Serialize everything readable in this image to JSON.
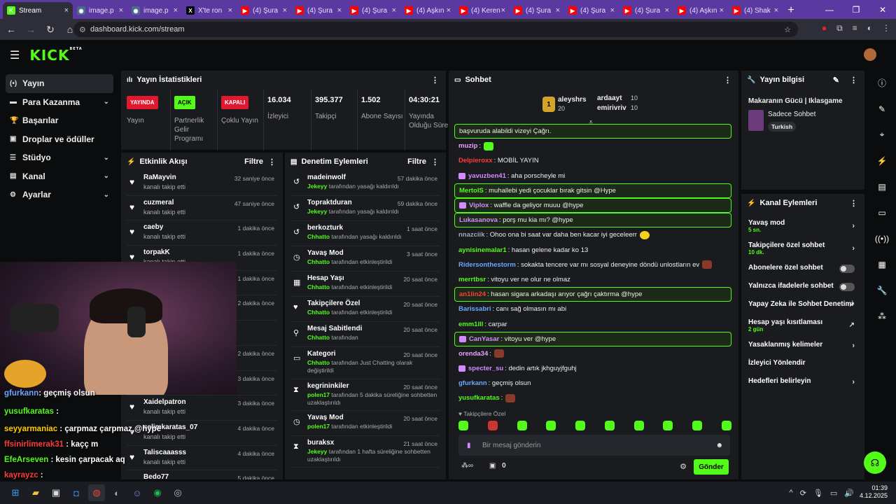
{
  "browser": {
    "tabs": [
      {
        "label": "Stream",
        "fav_color": "#53fc18",
        "fav_text": "K",
        "active": true
      },
      {
        "label": "image.p",
        "fav_color": "#4a6a8a",
        "fav_text": "◉"
      },
      {
        "label": "image.p",
        "fav_color": "#4a6a8a",
        "fav_text": "◉"
      },
      {
        "label": "X'te ron",
        "fav_color": "#000000",
        "fav_text": "X"
      },
      {
        "label": "(4) Şura",
        "fav_color": "#ff0000",
        "fav_text": "▶"
      },
      {
        "label": "(4) Şura",
        "fav_color": "#ff0000",
        "fav_text": "▶"
      },
      {
        "label": "(4) Şura",
        "fav_color": "#ff0000",
        "fav_text": "▶"
      },
      {
        "label": "(4) Aşkın",
        "fav_color": "#ff0000",
        "fav_text": "▶"
      },
      {
        "label": "(4) Keren",
        "fav_color": "#ff0000",
        "fav_text": "▶"
      },
      {
        "label": "(4) Şura",
        "fav_color": "#ff0000",
        "fav_text": "▶"
      },
      {
        "label": "(4) Şura",
        "fav_color": "#ff0000",
        "fav_text": "▶"
      },
      {
        "label": "(4) Şura",
        "fav_color": "#ff0000",
        "fav_text": "▶"
      },
      {
        "label": "(4) Aşkın",
        "fav_color": "#ff0000",
        "fav_text": "▶"
      },
      {
        "label": "(4) Shak",
        "fav_color": "#ff0000",
        "fav_text": "▶"
      }
    ],
    "url": "dashboard.kick.com/stream"
  },
  "sidebar": {
    "items": [
      {
        "label": "Yayın",
        "icon": "(•)",
        "active": true,
        "chevron": false
      },
      {
        "label": "Para Kazanma",
        "icon": "▬",
        "chevron": true
      },
      {
        "label": "Başarılar",
        "icon": "🏆",
        "chevron": false
      },
      {
        "label": "Droplar ve ödüller",
        "icon": "▣",
        "chevron": false
      },
      {
        "label": "Stüdyo",
        "icon": "☰",
        "chevron": true
      },
      {
        "label": "Kanal",
        "icon": "▤",
        "chevron": true
      },
      {
        "label": "Ayarlar",
        "icon": "⚙",
        "chevron": true
      }
    ]
  },
  "stats": {
    "title": "Yayın İstatistikleri",
    "items": [
      {
        "badge": "YAYINDA",
        "badge_color": "#e2182f",
        "label": "Yayın"
      },
      {
        "badge": "AÇIK",
        "badge_color": "#53fc18",
        "label": "Partnerlik Gelir Programı"
      },
      {
        "badge": "KAPALI",
        "badge_color": "#e2182f",
        "label": "Çoklu Yayın"
      },
      {
        "value": "16.034",
        "label": "İzleyici"
      },
      {
        "value": "395.377",
        "label": "Takipçi"
      },
      {
        "value": "1.502",
        "label": "Abone Sayısı"
      },
      {
        "value": "04:30:21",
        "label": "Yayında Olduğu Süre"
      }
    ]
  },
  "activity": {
    "title": "Etkinlik Akışı",
    "filter": "Filtre",
    "rows": [
      {
        "name": "RaMayvin",
        "sub": "kanalı takip etti",
        "time": "32 saniye önce"
      },
      {
        "name": "cuzmeral",
        "sub": "kanalı takip etti",
        "time": "47 saniye önce"
      },
      {
        "name": "caeby",
        "sub": "kanalı takip etti",
        "time": "1 dakika önce"
      },
      {
        "name": "torpakK",
        "sub": "kanalı takip etti",
        "time": "1 dakika önce"
      },
      {
        "name": "",
        "sub": "",
        "time": "1 dakika önce"
      },
      {
        "name": "",
        "sub": "",
        "time": "2 dakika önce"
      },
      {
        "name": "",
        "sub": "",
        "time": ""
      },
      {
        "name": "",
        "sub": "",
        "time": "2 dakika önce"
      },
      {
        "name": "",
        "sub": "",
        "time": "3 dakika önce"
      },
      {
        "name": "Xaidelpatron",
        "sub": "kanalı takip etti",
        "time": "3 dakika önce"
      },
      {
        "name": "selimkaratas_07",
        "sub": "kanalı takip etti",
        "time": "4 dakika önce"
      },
      {
        "name": "Taliscaaasss",
        "sub": "kanalı takip etti",
        "time": "4 dakika önce"
      },
      {
        "name": "Bedo77",
        "sub": "",
        "time": "5 dakika önce"
      }
    ]
  },
  "moderation": {
    "title": "Denetim Eylemleri",
    "filter": "Filtre",
    "rows": [
      {
        "icon": "↺",
        "name": "madeinwolf",
        "by": "Jekeyy",
        "sub": " tarafından yasağı kaldırıldı",
        "time": "57 dakika önce",
        "h": 36
      },
      {
        "icon": "↺",
        "name": "Topraktduran",
        "by": "Jekeyy",
        "sub": " tarafından yasağı kaldırıldı",
        "time": "59 dakika önce",
        "h": 36
      },
      {
        "icon": "↺",
        "name": "berkozturk",
        "by": "Chhatto",
        "sub": " tarafından yasağı kaldırıldı",
        "time": "1 saat önce",
        "h": 36
      },
      {
        "icon": "◷",
        "name": "Yavaş Mod",
        "by": "Chhatto",
        "sub": " tarafından etkinleştirildi",
        "time": "3 saat önce",
        "h": 36
      },
      {
        "icon": "▦",
        "name": "Hesap Yaşı",
        "by": "Chhatto",
        "sub": " tarafından etkinleştirildi",
        "time": "20 saat önce",
        "h": 36
      },
      {
        "icon": "♥",
        "name": "Takipçilere Özel",
        "by": "Chhatto",
        "sub": " tarafından etkinleştirildi",
        "time": "20 saat önce",
        "h": 36
      },
      {
        "icon": "⚲",
        "name": "Mesaj Sabitlendi",
        "by": "Chhatto",
        "sub": " tarafından",
        "time": "20 saat önce",
        "h": 36
      },
      {
        "icon": "▭",
        "name": "Kategori",
        "by": "Chhatto",
        "sub": " tarafından Just Chatting olarak değiştirildi",
        "time": "20 saat önce",
        "h": 46
      },
      {
        "icon": "⧗",
        "name": "kegrininkiler",
        "by": "polen17",
        "sub": " tarafından 5 dakika süreliğine sohbetten uzaklaştırıldı",
        "time": "20 saat önce",
        "h": 45
      },
      {
        "icon": "◷",
        "name": "Yavaş Mod",
        "by": "polen17",
        "sub": " tarafından etkinleştirildi",
        "time": "20 saat önce",
        "h": 36
      },
      {
        "icon": "⧗",
        "name": "buraksx",
        "by": "Jekeyy",
        "sub": " tarafından 1 hafta süreliğine sohbetten uzaklaştırıldı",
        "time": "21 saat önce",
        "h": 45
      }
    ]
  },
  "chat": {
    "title": "Sohbet",
    "top_gifters": [
      {
        "rank": "1",
        "name": "aleyshrs",
        "count": "20"
      },
      {
        "name": "ardaayt",
        "count": "10"
      },
      {
        "name": "emirivriv",
        "count": "10"
      }
    ],
    "messages": [
      {
        "user": "",
        "color": "#eee",
        "text": "başvuruda alabildi vizeyi Çağrı.",
        "hl": true
      },
      {
        "user": "muzip",
        "color": "#f0a0ff",
        "text": ":",
        "emote": "green"
      },
      {
        "user": "Delpieroxx",
        "color": "#ff3b3b",
        "text": ": MOBİL YAYIN"
      },
      {
        "user": "yavuzben41",
        "color": "#d38bff",
        "text": ": aha porscheyle mi",
        "badge": true
      },
      {
        "user": "MertolS",
        "color": "#53fc18",
        "text": ": muhallebi yedi çocuklar bırak gitsin @Hype",
        "hl": true
      },
      {
        "user": "Viplox",
        "color": "#d38bff",
        "text": ": waffle da geliyor muuu @hype",
        "hl": true,
        "badge": true
      },
      {
        "user": "Lukasanova",
        "color": "#d38bff",
        "text": ": porş mu kia mı? @hype",
        "hl": true
      },
      {
        "user": "nnazciik",
        "color": "#9ab",
        "text": ": Ohoo ona bi saat var daha ben kacar iyi geceleerr",
        "emote": "yellow"
      },
      {
        "user": "aynisinemalar1",
        "color": "#53fc18",
        "text": ": hasan gelene kadar ko 13"
      },
      {
        "user": "Ridersonthestorm",
        "color": "#6aa8ff",
        "text": ": sokakta tencere var mı sosyal deneyine döndü unlostların ev",
        "emote": "red"
      },
      {
        "user": "merrtbsr",
        "color": "#53fc18",
        "text": ": vitoyu ver ne olur ne olmaz"
      },
      {
        "user": "an1lin24",
        "color": "#ff3b3b",
        "text": ": hasan sigara arkadaşı arıyor çağrı çaktırma @hype",
        "hl": true
      },
      {
        "user": "Barissabri",
        "color": "#6aa8ff",
        "text": ": canı sağ olmasın mı abi"
      },
      {
        "user": "emm1lll",
        "color": "#53fc18",
        "text": ": carpar"
      },
      {
        "user": "CanYasar",
        "color": "#d38bff",
        "text": ": vitoyu ver @hype",
        "hl": true,
        "badge": true
      },
      {
        "user": "orenda34",
        "color": "#f0a0ff",
        "text": ":",
        "emote": "red"
      },
      {
        "user": "specter_su",
        "color": "#d38bff",
        "text": ": dedin artık jkhguyjfguhj",
        "badge": true
      },
      {
        "user": "gfurkann",
        "color": "#6aa8ff",
        "text": ": geçmiş olsun"
      },
      {
        "user": "yusufkaratas",
        "color": "#53fc18",
        "text": ":",
        "emote": "red"
      }
    ],
    "followers_only": "Takipçilere Özel",
    "placeholder": "Bir mesaj gönderin",
    "points": "0",
    "send": "Gönder"
  },
  "stream_info": {
    "title": "Yayın bilgisi",
    "stream_title": "Makaranın Gücü | Iklasgame",
    "category": "Sadece Sohbet",
    "tag": "Turkish"
  },
  "channel_actions": {
    "title": "Kanal Eylemleri",
    "rows": [
      {
        "label": "Yavaş mod",
        "sub": "5 sn.",
        "type": "chev"
      },
      {
        "label": "Takipçilere özel sohbet",
        "sub": "10 dk.",
        "type": "chev"
      },
      {
        "label": "Abonelere özel sohbet",
        "type": "toggle"
      },
      {
        "label": "Yalnızca ifadelerle sohbet",
        "type": "toggle"
      },
      {
        "label": "Yapay Zeka ile Sohbet Denetimi",
        "type": "ext"
      },
      {
        "label": "Hesap yaşı kısıtlaması",
        "sub": "2 gün",
        "type": "ext"
      },
      {
        "label": "Yasaklanmış kelimeler",
        "type": "chev"
      },
      {
        "label": "İzleyici Yönlendir",
        "type": "none"
      },
      {
        "label": "Hedefleri belirleyin",
        "type": "chev"
      }
    ]
  },
  "webcam_overlay": [
    {
      "user": "gfurkann",
      "text": ": geçmiş olsun",
      "color": "#6aa8ff"
    },
    {
      "user": "yusufkaratas",
      "text": " :",
      "color": "#53fc18"
    },
    {
      "user": "seyyarmaniac",
      "text": " : çarpmaz çarpmaz @hype",
      "color": "#ffcc00"
    },
    {
      "user": "ffsinirlimerak31",
      "text": " : kaçç m",
      "color": "#ff3b3b"
    },
    {
      "user": "EfeArseven",
      "text": " : kesin çarpacak aq",
      "color": "#53fc18"
    },
    {
      "user": "kayrayzc",
      "text": " :",
      "color": "#ff3b3b"
    }
  ],
  "taskbar": {
    "time": "01:39",
    "date": "4.12.2025"
  }
}
